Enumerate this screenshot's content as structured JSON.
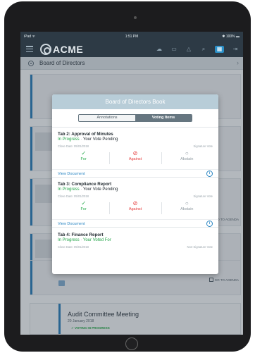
{
  "status_bar": {
    "carrier": "iPad ᯤ",
    "time": "1:51 PM",
    "battery": "✱ 100% ▬"
  },
  "nav": {
    "logo_text": "ACME",
    "icons": [
      "chat-icon",
      "book-icon",
      "bell-icon",
      "search-icon",
      "grid-icon",
      "logout-icon"
    ]
  },
  "breadcrumb": {
    "title": "Board of Directors"
  },
  "background": {
    "go_to_agenda": "GO TO AGENDA",
    "audit": {
      "title": "Audit Committee Meeting",
      "date": "20 January 2018",
      "status": "✓ VOTING IN PROGRESS"
    }
  },
  "modal": {
    "title": "Board of Directors Book",
    "tabs": [
      {
        "label": "Annotations"
      },
      {
        "label": "Voting Items"
      }
    ],
    "view_document": "View Document",
    "items": [
      {
        "title": "Tab 2: Approval of Minutes",
        "progress": "In Progress",
        "status": "Your Vote Pending",
        "close_date": "Close Date: 05/01/2018",
        "sig_type": "Signature Vote",
        "votes": [
          {
            "icon": "✓",
            "label": "For"
          },
          {
            "icon": "⊘",
            "label": "Against"
          },
          {
            "icon": "○",
            "label": "Abstain"
          }
        ]
      },
      {
        "title": "Tab 3: Compliance Report",
        "progress": "In Progress",
        "status": "Your Vote Pending",
        "close_date": "Close Date: 05/01/2018",
        "sig_type": "Signature Vote",
        "votes": [
          {
            "icon": "✓",
            "label": "For"
          },
          {
            "icon": "⊘",
            "label": "Against"
          },
          {
            "icon": "○",
            "label": "Abstain"
          }
        ]
      },
      {
        "title": "Tab 4: Finance Report",
        "progress": "In Progress",
        "status": "Your Voted For",
        "close_date": "Close Date: 05/01/2018",
        "sig_type": "Non-Signature Vote"
      }
    ]
  },
  "colors": {
    "accent_blue": "#2a86c3",
    "for_green": "#23a94a",
    "against_red": "#e53b3b",
    "header_bg": "#2d3a45"
  }
}
